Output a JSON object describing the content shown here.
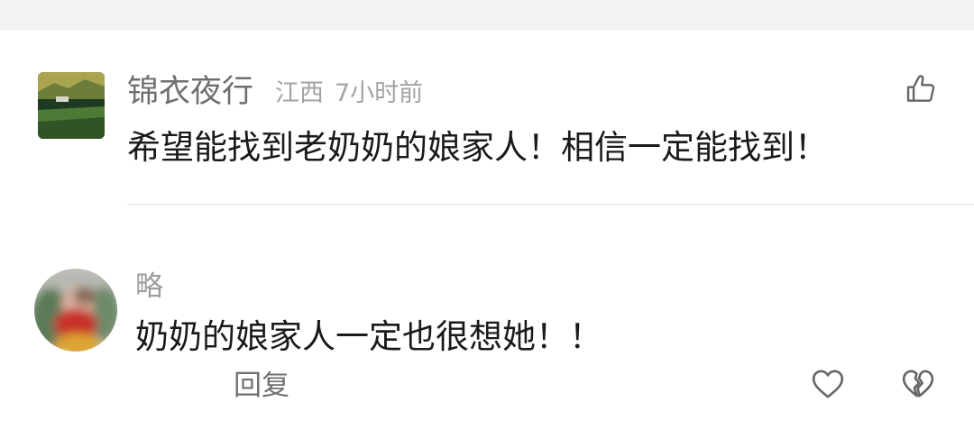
{
  "comments": [
    {
      "username": "锦衣夜行",
      "location": "江西",
      "time": "7小时前",
      "text": "希望能找到老奶奶的娘家人！相信一定能找到！",
      "like_icon": "thumbs-up-icon"
    },
    {
      "username": "略",
      "text": "奶奶的娘家人一定也很想她！！",
      "reply_label": "回复",
      "like_icon": "heart-icon",
      "dislike_icon": "broken-heart-icon"
    }
  ],
  "colors": {
    "username": "#6f6f6f",
    "meta": "#a3a3a3",
    "text": "#1a1a1a",
    "icon": "#666666",
    "background": "#ffffff",
    "top_strip": "#f3f3f3"
  }
}
